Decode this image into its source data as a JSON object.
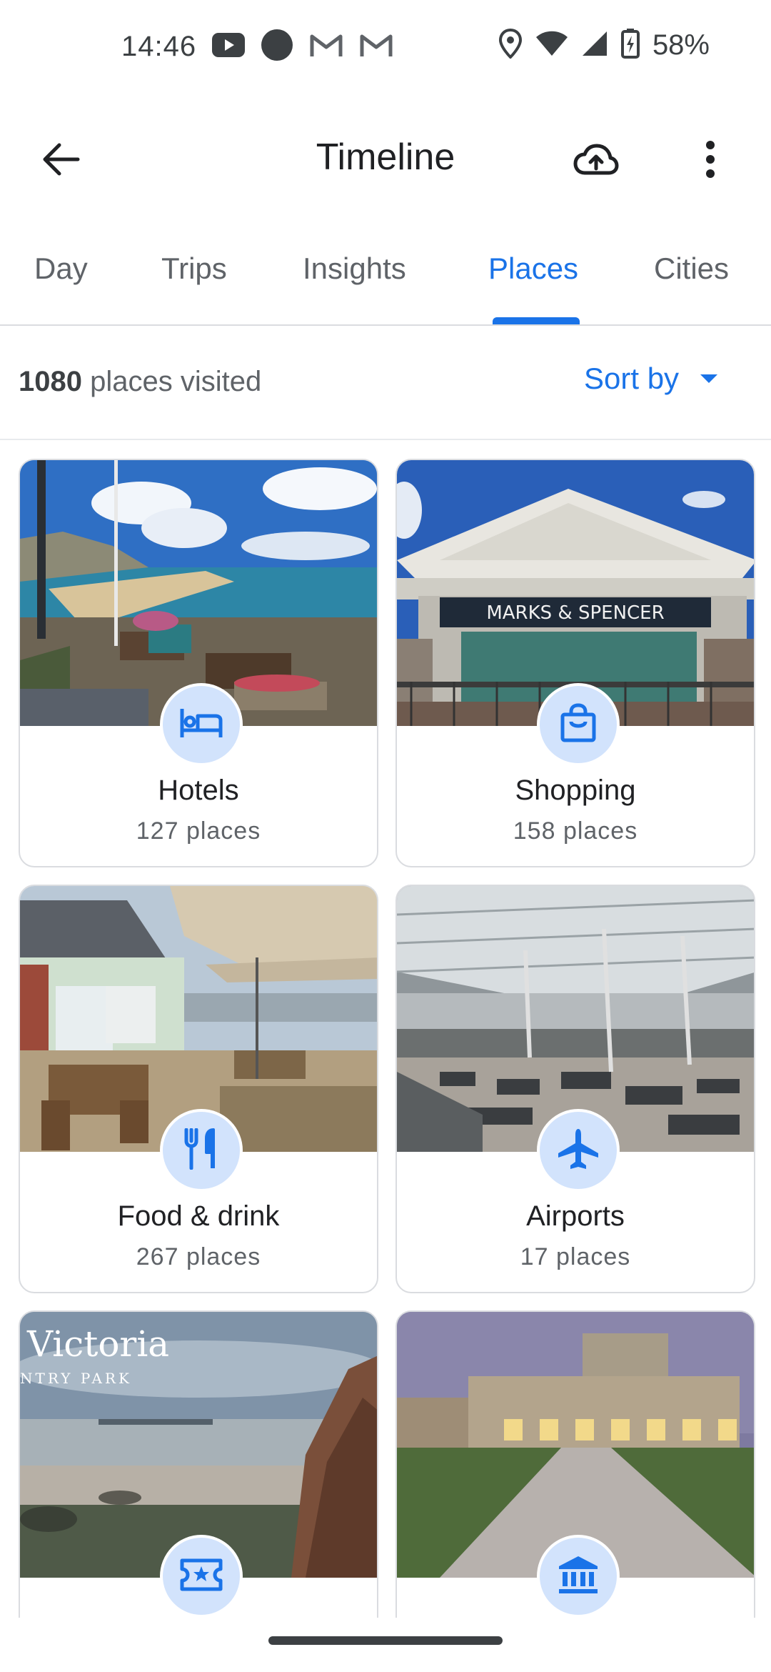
{
  "status_bar": {
    "time": "14:46",
    "battery_percent": "58%",
    "icons_left": [
      "youtube-icon",
      "dot-icon",
      "gmail-icon",
      "gmail-icon"
    ],
    "icons_right": [
      "location-icon",
      "wifi-icon",
      "signal-icon",
      "battery-charging-icon"
    ]
  },
  "app_bar": {
    "title": "Timeline",
    "back_icon": "arrow-back-icon",
    "upload_icon": "cloud-upload-icon",
    "more_icon": "more-vert-icon"
  },
  "tabs": [
    {
      "label": "Day",
      "active": false
    },
    {
      "label": "Trips",
      "active": false
    },
    {
      "label": "Insights",
      "active": false
    },
    {
      "label": "Places",
      "active": true
    },
    {
      "label": "Cities",
      "active": false
    }
  ],
  "summary": {
    "count": "1080",
    "count_suffix": " places visited",
    "sort_label": "Sort by"
  },
  "cards": [
    {
      "title": "Hotels",
      "subtitle": "127 places",
      "icon": "hotel-bed-icon",
      "photo": "seaside-beach-photo"
    },
    {
      "title": "Shopping",
      "subtitle": "158 places",
      "icon": "shopping-bag-icon",
      "photo": "store-front-photo",
      "photo_text": "MARKS & SPENCER"
    },
    {
      "title": "Food & drink",
      "subtitle": "267 places",
      "icon": "restaurant-icon",
      "photo": "patio-restaurant-photo"
    },
    {
      "title": "Airports",
      "subtitle": "17 places",
      "icon": "airplane-icon",
      "photo": "airport-terminal-photo"
    },
    {
      "title": "",
      "subtitle": "",
      "icon": "ticket-star-icon",
      "photo": "coast-park-photo",
      "photo_text": "Victoria",
      "photo_subtext": "NTRY PARK"
    },
    {
      "title": "",
      "subtitle": "",
      "icon": "museum-icon",
      "photo": "historic-building-photo"
    }
  ],
  "colors": {
    "accent": "#1a73e8",
    "badge_bg": "#d2e3fc",
    "text_primary": "#202124",
    "text_secondary": "#5f6368"
  }
}
